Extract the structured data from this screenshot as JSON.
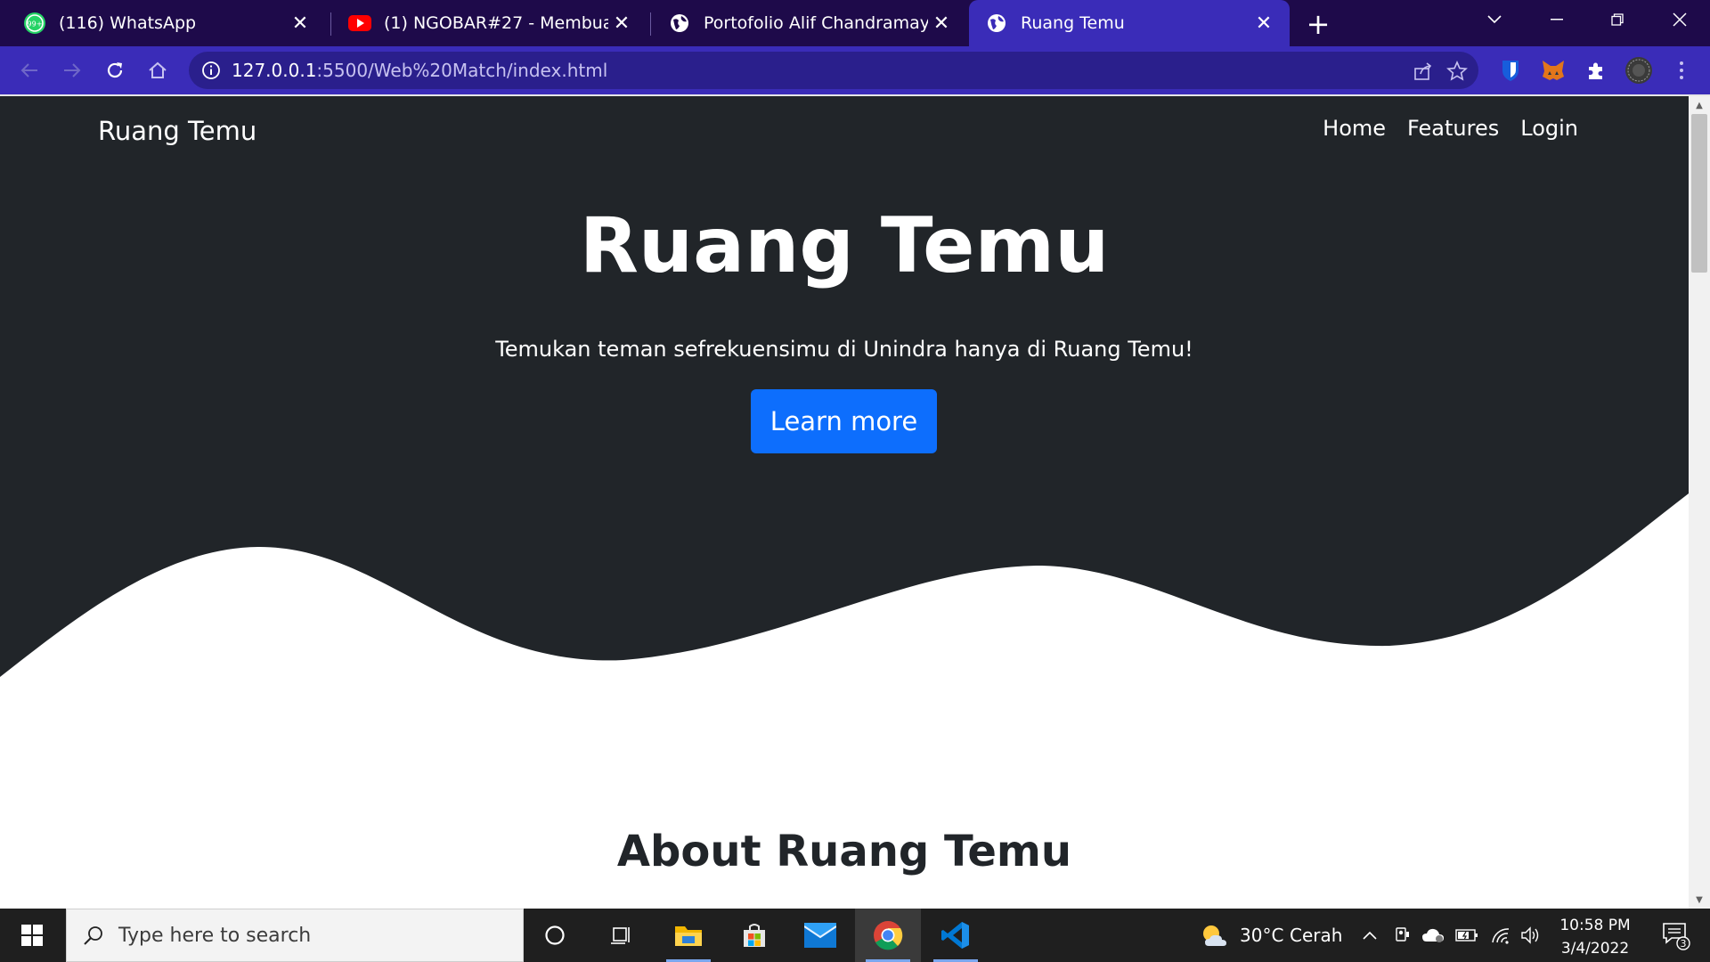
{
  "browser": {
    "tabs": [
      {
        "title": "(116) WhatsApp",
        "icon": "whatsapp-icon",
        "badge": "99+"
      },
      {
        "title": "(1) NGOBAR#27 - Membuat Web",
        "icon": "youtube-icon"
      },
      {
        "title": "Portofolio Alif Chandramaya",
        "icon": "globe-icon"
      },
      {
        "title": "Ruang Temu",
        "icon": "globe-icon",
        "active": true
      }
    ],
    "tab_close_glyph": "✕",
    "new_tab_glyph": "+",
    "address": {
      "host": "127.0.0.1",
      "path": ":5500/Web%20Match/index.html"
    },
    "colors": {
      "tabstrip": "#1e0a4a",
      "toolbar": "#3a2cb8",
      "omnibox": "#2a1f8c"
    }
  },
  "site": {
    "brand": "Ruang Temu",
    "nav": [
      "Home",
      "Features",
      "Login"
    ],
    "hero_title": "Ruang Temu",
    "hero_subtitle": "Temukan teman sefrekuensimu di Unindra hanya di Ruang Temu!",
    "cta_label": "Learn more",
    "about_title": "About Ruang Temu",
    "colors": {
      "hero_bg": "#212529",
      "cta": "#0d6efd",
      "text_dark": "#212529"
    }
  },
  "taskbar": {
    "search_placeholder": "Type here to search",
    "weather": {
      "temp": "30°C",
      "desc": "Cerah"
    },
    "time": "10:58 PM",
    "date": "3/4/2022",
    "notification_count": "3"
  }
}
